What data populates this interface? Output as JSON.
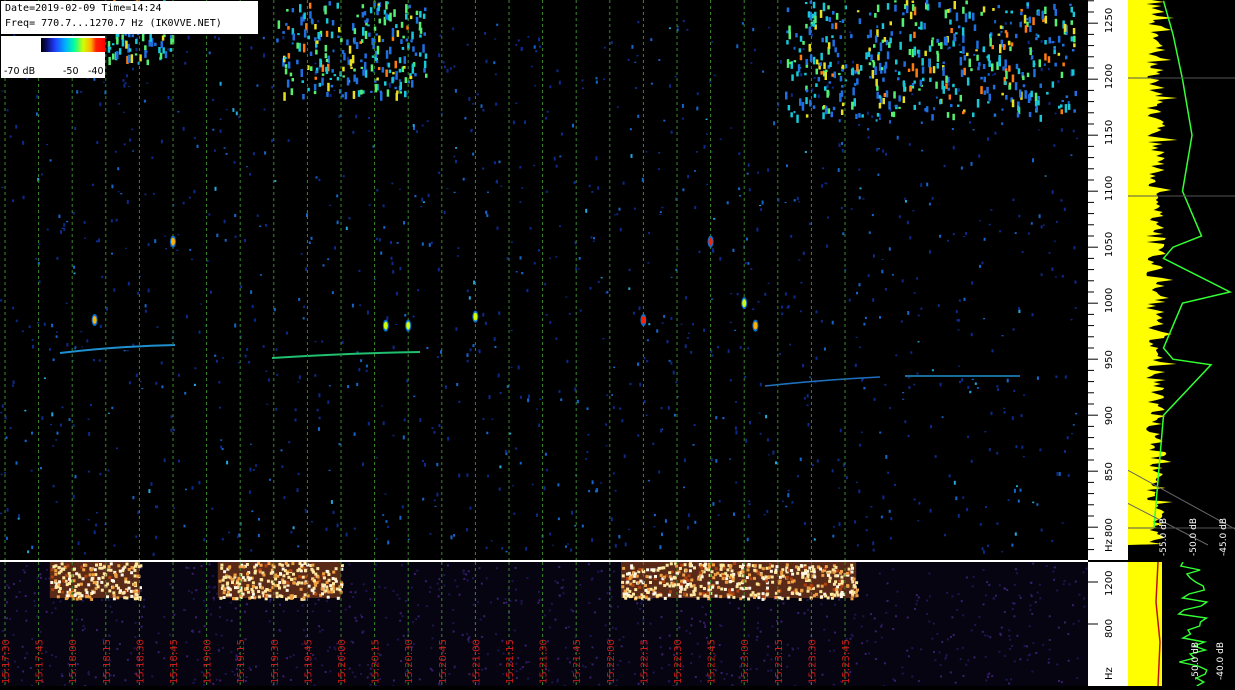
{
  "header": {
    "date_line": "Date=2019-02-09 Time=14:24",
    "freq_line": "Freq= 770.7...1270.7 Hz (IK0VVE.NET)"
  },
  "legend": {
    "labels": [
      "-70 dB",
      "-50",
      "-40"
    ]
  },
  "colors": {
    "background": "#000000",
    "time_grid": "#3a8a2a",
    "time_labels": "#cc1a1a",
    "spectrum_level": "#ffff00",
    "spectrum_avg": "#33ff33",
    "strong_echo": "#ff2000"
  },
  "chart_data": [
    {
      "type": "heatmap",
      "title": "",
      "xlabel": "",
      "ylabel": "Hz",
      "ylim": [
        770.7,
        1270.7
      ],
      "y_ticks": [
        800,
        850,
        900,
        950,
        1000,
        1050,
        1100,
        1150,
        1200,
        1250
      ],
      "time_ticks": [
        "15:17:30",
        "15:17:45",
        "15:18:00",
        "15:18:15",
        "15:18:30",
        "15:18:45",
        "15:19:00",
        "15:19:15",
        "15:19:30",
        "15:19:45",
        "15:20:00",
        "15:20:15",
        "15:20:30",
        "15:20:45",
        "15:21:00",
        "15:21:15",
        "15:21:30",
        "15:21:45",
        "15:22:00",
        "15:22:15",
        "15:22:30",
        "15:22:45",
        "15:23:00",
        "15:23:15",
        "15:23:30",
        "15:23:45"
      ],
      "color_scale_db": [
        -70,
        -40
      ],
      "grid": true,
      "echoes": [
        {
          "t": "15:18:10",
          "freq": 985,
          "level_db": -45
        },
        {
          "t": "15:18:45",
          "freq": 1055,
          "level_db": -48
        },
        {
          "t": "15:20:20",
          "freq": 980,
          "level_db": -50
        },
        {
          "t": "15:20:30",
          "freq": 980,
          "level_db": -49
        },
        {
          "t": "15:21:00",
          "freq": 988,
          "level_db": -52
        },
        {
          "t": "15:22:15",
          "freq": 985,
          "level_db": -44
        },
        {
          "t": "15:22:45",
          "freq": 1055,
          "level_db": -41
        },
        {
          "t": "15:23:00",
          "freq": 1000,
          "level_db": -50
        },
        {
          "t": "15:23:05",
          "freq": 980,
          "level_db": -47
        }
      ]
    },
    {
      "type": "line",
      "title": "",
      "xlabel": "",
      "ylabel": "Hz",
      "series": [
        {
          "x_db": [
            -57,
            -56,
            -55,
            -54,
            -55,
            -53,
            -56,
            -57,
            -50,
            -55,
            -57,
            -56,
            -52,
            -57,
            -58
          ],
          "y": [
            1270,
            1240,
            1200,
            1150,
            1100,
            1060,
            1050,
            1040,
            1010,
            1000,
            960,
            950,
            945,
            900,
            800
          ]
        }
      ],
      "x_ticks": [
        "-55.0 dB",
        "-50.0 dB",
        "-45.0 dB"
      ],
      "y_ticks": [
        800,
        850,
        900,
        950,
        1000,
        1050,
        1100,
        1150,
        1200,
        1250
      ]
    },
    {
      "type": "heatmap",
      "title": "",
      "ylabel": "Hz",
      "y_ticks": [
        800,
        1200
      ],
      "x_ticks": [
        "-50.0 dB",
        "-40.0 dB"
      ],
      "bursts": [
        {
          "start": "15:17:50",
          "end": "15:18:30"
        },
        {
          "start": "15:19:05",
          "end": "15:20:00"
        },
        {
          "start": "15:22:05",
          "end": "15:23:50"
        }
      ]
    }
  ]
}
